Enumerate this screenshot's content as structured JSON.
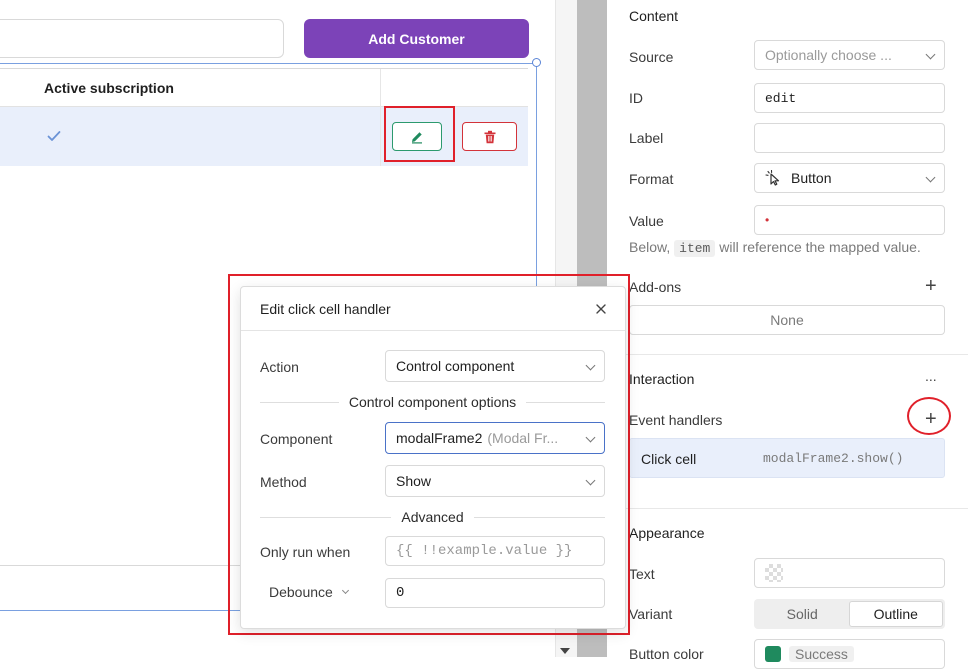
{
  "canvas": {
    "add_customer_label": "Add Customer",
    "table": {
      "columns": [
        "Active subscription"
      ],
      "rows": [
        {
          "active_subscription": true
        }
      ]
    }
  },
  "modal": {
    "title": "Edit click cell handler",
    "action_label": "Action",
    "action_value": "Control component",
    "options_heading": "Control component options",
    "component_label": "Component",
    "component_value": "modalFrame2",
    "component_hint": "(Modal Fr...",
    "method_label": "Method",
    "method_value": "Show",
    "advanced_heading": "Advanced",
    "only_run_label": "Only run when",
    "only_run_placeholder": "{{ !!example.value }}",
    "debounce_label": "Debounce",
    "debounce_value": "0"
  },
  "inspector": {
    "content_title": "Content",
    "source_label": "Source",
    "source_placeholder": "Optionally choose ...",
    "id_label": "ID",
    "id_value": "edit",
    "label_label": "Label",
    "label_value": "",
    "format_label": "Format",
    "format_value": "Button",
    "value_label": "Value",
    "value_value": "•",
    "hint_prefix": "Below,",
    "hint_code": "item",
    "hint_suffix": "will reference the mapped value.",
    "addons_label": "Add-ons",
    "addons_none": "None",
    "interaction_title": "Interaction",
    "interaction_more": "...",
    "event_handlers_label": "Event handlers",
    "handler_event": "Click cell",
    "handler_code": "modalFrame2.show()",
    "appearance_title": "Appearance",
    "text_label": "Text",
    "variant_label": "Variant",
    "variant_options": [
      "Solid",
      "Outline"
    ],
    "variant_selected": "Outline",
    "button_color_label": "Button color",
    "button_color_value": "Success"
  },
  "colors": {
    "accent_purple": "#7c43b8",
    "success_green": "#2c9a6e",
    "danger_red": "#d3333a",
    "selection_blue": "#5b85d6",
    "annotation_red": "#e0202a"
  }
}
